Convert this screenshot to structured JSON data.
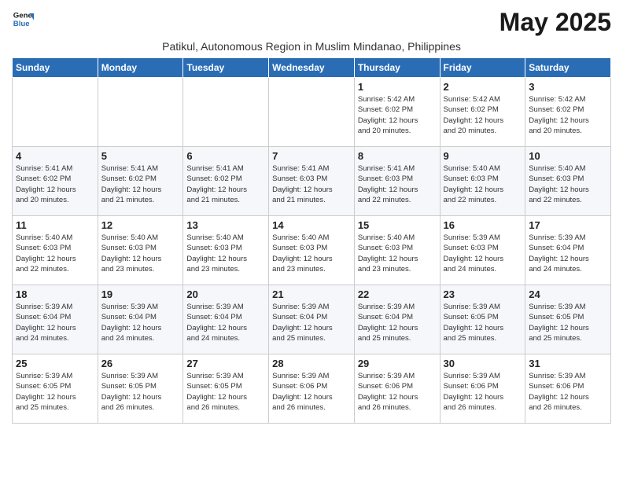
{
  "header": {
    "logo_line1": "General",
    "logo_line2": "Blue",
    "month_title": "May 2025",
    "subtitle": "Patikul, Autonomous Region in Muslim Mindanao, Philippines"
  },
  "days_of_week": [
    "Sunday",
    "Monday",
    "Tuesday",
    "Wednesday",
    "Thursday",
    "Friday",
    "Saturday"
  ],
  "weeks": [
    [
      {
        "day": "",
        "info": ""
      },
      {
        "day": "",
        "info": ""
      },
      {
        "day": "",
        "info": ""
      },
      {
        "day": "",
        "info": ""
      },
      {
        "day": "1",
        "info": "Sunrise: 5:42 AM\nSunset: 6:02 PM\nDaylight: 12 hours\nand 20 minutes."
      },
      {
        "day": "2",
        "info": "Sunrise: 5:42 AM\nSunset: 6:02 PM\nDaylight: 12 hours\nand 20 minutes."
      },
      {
        "day": "3",
        "info": "Sunrise: 5:42 AM\nSunset: 6:02 PM\nDaylight: 12 hours\nand 20 minutes."
      }
    ],
    [
      {
        "day": "4",
        "info": "Sunrise: 5:41 AM\nSunset: 6:02 PM\nDaylight: 12 hours\nand 20 minutes."
      },
      {
        "day": "5",
        "info": "Sunrise: 5:41 AM\nSunset: 6:02 PM\nDaylight: 12 hours\nand 21 minutes."
      },
      {
        "day": "6",
        "info": "Sunrise: 5:41 AM\nSunset: 6:02 PM\nDaylight: 12 hours\nand 21 minutes."
      },
      {
        "day": "7",
        "info": "Sunrise: 5:41 AM\nSunset: 6:03 PM\nDaylight: 12 hours\nand 21 minutes."
      },
      {
        "day": "8",
        "info": "Sunrise: 5:41 AM\nSunset: 6:03 PM\nDaylight: 12 hours\nand 22 minutes."
      },
      {
        "day": "9",
        "info": "Sunrise: 5:40 AM\nSunset: 6:03 PM\nDaylight: 12 hours\nand 22 minutes."
      },
      {
        "day": "10",
        "info": "Sunrise: 5:40 AM\nSunset: 6:03 PM\nDaylight: 12 hours\nand 22 minutes."
      }
    ],
    [
      {
        "day": "11",
        "info": "Sunrise: 5:40 AM\nSunset: 6:03 PM\nDaylight: 12 hours\nand 22 minutes."
      },
      {
        "day": "12",
        "info": "Sunrise: 5:40 AM\nSunset: 6:03 PM\nDaylight: 12 hours\nand 23 minutes."
      },
      {
        "day": "13",
        "info": "Sunrise: 5:40 AM\nSunset: 6:03 PM\nDaylight: 12 hours\nand 23 minutes."
      },
      {
        "day": "14",
        "info": "Sunrise: 5:40 AM\nSunset: 6:03 PM\nDaylight: 12 hours\nand 23 minutes."
      },
      {
        "day": "15",
        "info": "Sunrise: 5:40 AM\nSunset: 6:03 PM\nDaylight: 12 hours\nand 23 minutes."
      },
      {
        "day": "16",
        "info": "Sunrise: 5:39 AM\nSunset: 6:03 PM\nDaylight: 12 hours\nand 24 minutes."
      },
      {
        "day": "17",
        "info": "Sunrise: 5:39 AM\nSunset: 6:04 PM\nDaylight: 12 hours\nand 24 minutes."
      }
    ],
    [
      {
        "day": "18",
        "info": "Sunrise: 5:39 AM\nSunset: 6:04 PM\nDaylight: 12 hours\nand 24 minutes."
      },
      {
        "day": "19",
        "info": "Sunrise: 5:39 AM\nSunset: 6:04 PM\nDaylight: 12 hours\nand 24 minutes."
      },
      {
        "day": "20",
        "info": "Sunrise: 5:39 AM\nSunset: 6:04 PM\nDaylight: 12 hours\nand 24 minutes."
      },
      {
        "day": "21",
        "info": "Sunrise: 5:39 AM\nSunset: 6:04 PM\nDaylight: 12 hours\nand 25 minutes."
      },
      {
        "day": "22",
        "info": "Sunrise: 5:39 AM\nSunset: 6:04 PM\nDaylight: 12 hours\nand 25 minutes."
      },
      {
        "day": "23",
        "info": "Sunrise: 5:39 AM\nSunset: 6:05 PM\nDaylight: 12 hours\nand 25 minutes."
      },
      {
        "day": "24",
        "info": "Sunrise: 5:39 AM\nSunset: 6:05 PM\nDaylight: 12 hours\nand 25 minutes."
      }
    ],
    [
      {
        "day": "25",
        "info": "Sunrise: 5:39 AM\nSunset: 6:05 PM\nDaylight: 12 hours\nand 25 minutes."
      },
      {
        "day": "26",
        "info": "Sunrise: 5:39 AM\nSunset: 6:05 PM\nDaylight: 12 hours\nand 26 minutes."
      },
      {
        "day": "27",
        "info": "Sunrise: 5:39 AM\nSunset: 6:05 PM\nDaylight: 12 hours\nand 26 minutes."
      },
      {
        "day": "28",
        "info": "Sunrise: 5:39 AM\nSunset: 6:06 PM\nDaylight: 12 hours\nand 26 minutes."
      },
      {
        "day": "29",
        "info": "Sunrise: 5:39 AM\nSunset: 6:06 PM\nDaylight: 12 hours\nand 26 minutes."
      },
      {
        "day": "30",
        "info": "Sunrise: 5:39 AM\nSunset: 6:06 PM\nDaylight: 12 hours\nand 26 minutes."
      },
      {
        "day": "31",
        "info": "Sunrise: 5:39 AM\nSunset: 6:06 PM\nDaylight: 12 hours\nand 26 minutes."
      }
    ]
  ]
}
